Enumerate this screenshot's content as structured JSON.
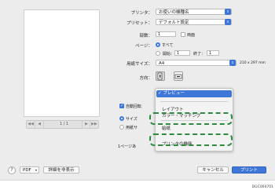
{
  "printer": {
    "label": "プリンタ：",
    "value": "お使いの機種名"
  },
  "preset": {
    "label": "プリセット：",
    "value": "デフォルト設定"
  },
  "copies": {
    "label": "部数：",
    "value": "1",
    "two_sided_label": "両面"
  },
  "pages": {
    "label": "ページ：",
    "all_label": "すべて",
    "from_label": "開始：",
    "from_value": "1",
    "to_label": "終了：",
    "to_value": "1"
  },
  "paper_size": {
    "label": "用紙サイズ：",
    "value": "A4",
    "dimensions": "210 x 297 mm"
  },
  "orientation": {
    "label": "方向："
  },
  "preview": {
    "page_indicator": "1 / 1",
    "first": "◀◀",
    "prev": "◀",
    "next": "▶",
    "last": "▶▶"
  },
  "left_options": {
    "auto_rotate": "自動回転",
    "size_radio": "サイズ",
    "paper_radio": "用紙サ",
    "per_page": "1ページあ"
  },
  "menu": {
    "selected": "プレビュー",
    "items": [
      "レイアウト",
      "カラー・マッチング",
      "給紙",
      "プリンタの機能"
    ]
  },
  "bottom": {
    "help": "?",
    "pdf": "PDF",
    "details": "詳細を非表示",
    "cancel": "キャンセル",
    "print": "プリント"
  },
  "figure_code": "DGC004701",
  "colors": {
    "accent": "#3f77d8",
    "highlight_dash": "#2e8b3e"
  }
}
